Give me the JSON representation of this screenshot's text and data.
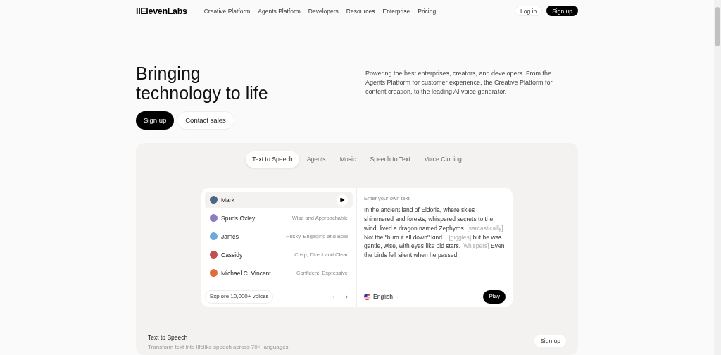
{
  "nav": {
    "logo": "IIElevenLabs",
    "links": [
      "Creative Platform",
      "Agents Platform",
      "Developers",
      "Resources",
      "Enterprise",
      "Pricing"
    ],
    "login": "Log in",
    "signup": "Sign up"
  },
  "hero": {
    "title_lines": [
      "Bringing",
      "technology to life"
    ],
    "description": "Powering the best enterprises, creators, and developers. From the Agents Platform for customer experience, the Creative Platform for content creation, to the leading AI voice generator.",
    "primary": "Sign up",
    "secondary": "Contact sales"
  },
  "tabs": [
    {
      "label": "Text to Speech",
      "selected": true
    },
    {
      "label": "Agents",
      "selected": false
    },
    {
      "label": "Music",
      "selected": false
    },
    {
      "label": "Speech to Text",
      "selected": false
    },
    {
      "label": "Voice Cloning",
      "selected": false
    }
  ],
  "voices": [
    {
      "name": "Mark",
      "selected": true,
      "color": "#4b6584"
    },
    {
      "name": "Spuds Oxley",
      "description": "Wise and Approachable",
      "selected": false,
      "color": "#8e7cc3"
    },
    {
      "name": "James",
      "description": "Husky, Engaging and Bold",
      "selected": false,
      "color": "#6fa8dc"
    },
    {
      "name": "Cassidy",
      "description": "Crisp, Direct and Clear",
      "selected": false,
      "color": "#c0504d"
    },
    {
      "name": "Michael C. Vincent",
      "description": "Confident, Expressive",
      "selected": false,
      "color": "#e06c3c"
    }
  ],
  "explore": "Explore 10,000+ voices",
  "editor": {
    "label": "Enter your own text",
    "segments": [
      {
        "kind": "text",
        "text": "In the ancient land of Eldoria, where skies shimmered and forests, whispered secrets to the wind, lived a dragon named Zephyros. "
      },
      {
        "kind": "tag",
        "text": "[sarcastically]"
      },
      {
        "kind": "text",
        "text": " Not the \"burn it all down\" kind... "
      },
      {
        "kind": "tag",
        "text": "[giggles]"
      },
      {
        "kind": "text",
        "text": " but he was gentle, wise, with eyes like old stars. "
      },
      {
        "kind": "tag",
        "text": "[whispers]"
      },
      {
        "kind": "text",
        "text": " Even the birds fell silent when he passed."
      }
    ],
    "language": "English",
    "play": "Play"
  },
  "footer_card": {
    "title": "Text to Speech",
    "subtitle": "Transform text into lifelike speech across 70+ languages",
    "button": "Sign up"
  }
}
